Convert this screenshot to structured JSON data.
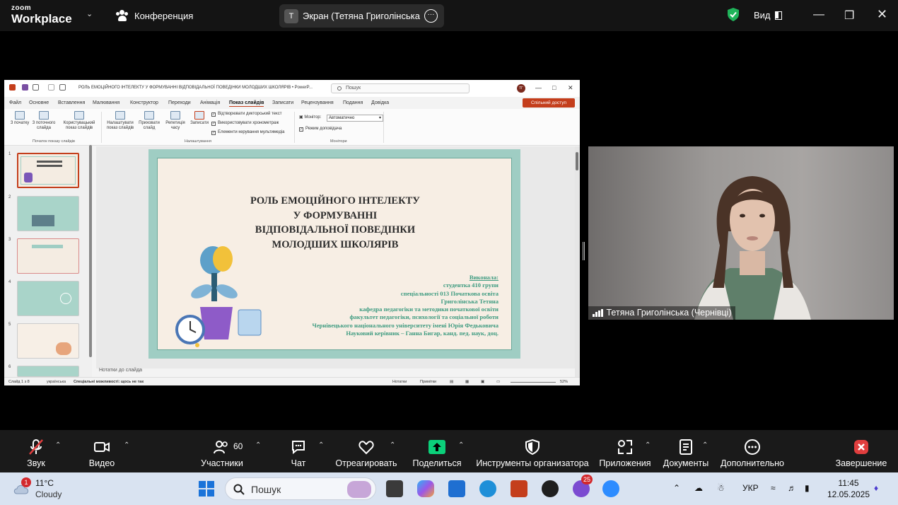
{
  "topbar": {
    "logo_line1": "zoom",
    "logo_line2": "Workplace",
    "conference_label": "Конференция",
    "screen_pill_badge": "T",
    "screen_pill_text": "Экран (Тетяна Григолінська (Чер",
    "view_label": "Вид",
    "shield_color": "#1fb35a"
  },
  "ppt": {
    "doc_title": "РОЛЬ ЕМОЦІЙНОГО ІНТЕЛЕКТУ У ФОРМУВАННІ ВІДПОВІДАЛЬНОЇ ПОВЕДІНКИ МОЛОДШИХ ШКОЛЯРІВ  •  PowerP...",
    "search_placeholder": "Пошук",
    "avatar_initials": "ТГ",
    "share_label": "Спільний доступ",
    "menu": [
      "Файл",
      "Основне",
      "Вставлення",
      "Малювання",
      "Конструктор",
      "Переходи",
      "Анімація",
      "Показ слайдів",
      "Записати",
      "Рецензування",
      "Подання",
      "Довідка"
    ],
    "ribbon": {
      "from_start": "З початку",
      "from_current": "З поточного слайда",
      "custom_show": "Користувацький показ слайдів",
      "group_start": "Початок показу слайдів",
      "setup_show": "Налаштувати показ слайдів",
      "hide_slide": "Приховати слайд",
      "rehearse": "Репетиція часу",
      "record": "Записати",
      "chk_narration": "Відтворювати дикторський текст",
      "chk_timings": "Використовувати хронометраж",
      "chk_media": "Елементи керування мультимедіа",
      "group_setup": "Налаштування",
      "monitor_label": "Монітор:",
      "monitor_value": "Автоматично",
      "chk_presenter": "Режим доповідача",
      "group_monitors": "Монітори"
    },
    "thumb_numbers": [
      "1",
      "2",
      "3",
      "4",
      "5",
      "6"
    ],
    "slide": {
      "title_lines": [
        "РОЛЬ ЕМОЦІЙНОГО ІНТЕЛЕКТУ",
        "У ФОРМУВАННІ",
        "ВІДПОВІДАЛЬНОЇ ПОВЕДІНКИ",
        "МОЛОДШИХ ШКОЛЯРІВ"
      ],
      "info_lines": [
        "Виконала:",
        "студентка 410 групи",
        "спеціальності 013 Початкова освіта",
        "Григолінська Тетяна",
        "кафедра педагогіки та методики початкової освіти",
        "факультет педагогіки, психології та соціальної роботи",
        "Чернівецького національного університету імені Юрія Федьковича",
        "Науковий керівник – Ганна Бигар, канд. пед. наук, доц."
      ]
    },
    "notes_label": "Нотатки до слайда",
    "status": {
      "slide_count": "Слайд 1 з 8",
      "language": "українська",
      "accessibility": "Спеціальні можливості: щось не так",
      "notes": "Нотатки",
      "comments": "Примітки",
      "zoom": "52%"
    }
  },
  "video": {
    "participant_name": "Тетяна Григолінська (Чернівці)"
  },
  "toolbar": {
    "audio": "Звук",
    "video": "Видео",
    "participants": "Участники",
    "participants_count": "60",
    "chat": "Чат",
    "react": "Отреагировать",
    "share": "Поделиться",
    "host_tools": "Инструменты организатора",
    "apps": "Приложения",
    "docs": "Документы",
    "more": "Дополнительно",
    "end": "Завершение",
    "share_color": "#0bd07a",
    "end_color": "#e03e3e"
  },
  "taskbar": {
    "weather_badge": "1",
    "temperature": "11°C",
    "condition": "Cloudy",
    "search_placeholder": "Пошук",
    "viber_badge": "25",
    "lang": "УКР",
    "time": "11:45",
    "date": "12.05.2025"
  }
}
